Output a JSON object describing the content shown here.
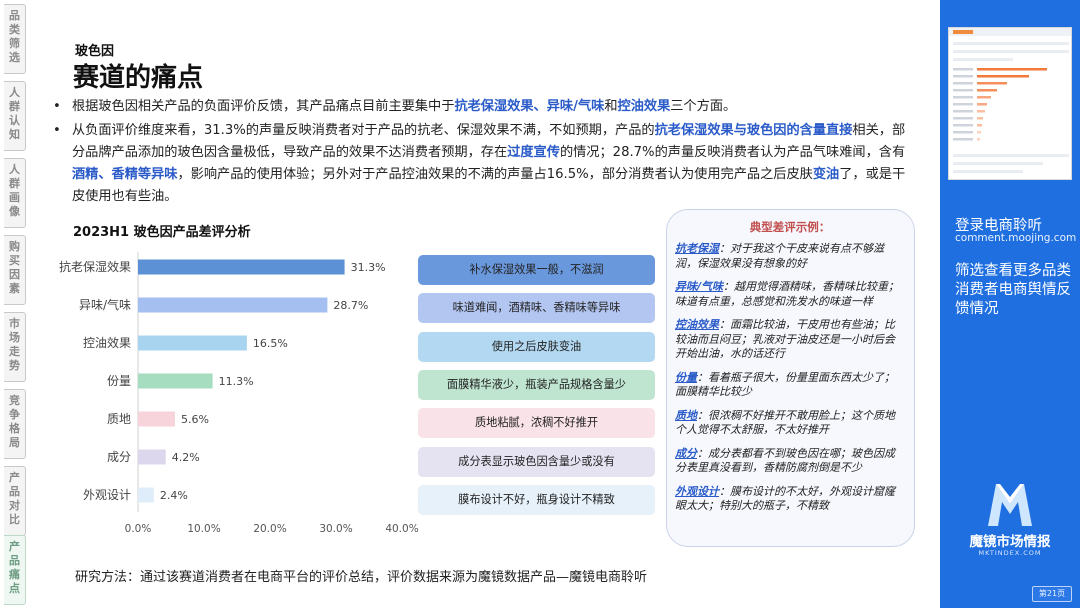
{
  "left_tabs": [
    {
      "label": [
        "品",
        "类",
        "筛",
        "选"
      ],
      "active": false
    },
    {
      "label": [
        "人",
        "群",
        "认",
        "知"
      ],
      "active": false
    },
    {
      "label": [
        "人",
        "群",
        "画",
        "像"
      ],
      "active": false
    },
    {
      "label": [
        "购",
        "买",
        "因",
        "素"
      ],
      "active": false
    },
    {
      "label": [
        "市",
        "场",
        "走",
        "势"
      ],
      "active": false
    },
    {
      "label": [
        "竞",
        "争",
        "格",
        "局"
      ],
      "active": false
    },
    {
      "label": [
        "产",
        "品",
        "对",
        "比"
      ],
      "active": false
    },
    {
      "label": [
        "产",
        "品",
        "痛",
        "点"
      ],
      "active": true
    }
  ],
  "header": {
    "subtitle": "玻色因",
    "title": "赛道的痛点"
  },
  "bullets": [
    {
      "segments": [
        {
          "t": "根据玻色因相关产品的负面评价反馈，其产品痛点目前主要集中于",
          "hl": false
        },
        {
          "t": "抗老保湿效果、异味/气味",
          "hl": true
        },
        {
          "t": "和",
          "hl": false
        },
        {
          "t": "控油效果",
          "hl": true
        },
        {
          "t": "三个方面。",
          "hl": false
        }
      ]
    },
    {
      "segments": [
        {
          "t": "从负面评价维度来看，31.3%的声量反映消费者对于产品的抗老、保湿效果不满，不如预期，产品的",
          "hl": false
        },
        {
          "t": "抗老保湿效果与玻色因的含量直接",
          "hl": true
        },
        {
          "t": "相关，部分品牌产品添加的玻色因含量极低，导致产品的效果不达消费者预期，存在",
          "hl": false
        },
        {
          "t": "过度宣传",
          "hl": true
        },
        {
          "t": "的情况；28.7%的声量反映消费者认为产品气味难闻，含有",
          "hl": false
        },
        {
          "t": "酒精、香精等异味",
          "hl": true
        },
        {
          "t": "，影响产品的使用体验；另外对于产品控油效果的不满的声量占16.5%，部分消费者认为使用完产品之后皮肤",
          "hl": false
        },
        {
          "t": "变油",
          "hl": true
        },
        {
          "t": "了，或是干皮使用也有些油。",
          "hl": false
        }
      ]
    }
  ],
  "chart_title": "2023H1 玻色因产品差评分析",
  "chart_data": {
    "type": "bar",
    "orientation": "horizontal",
    "categories": [
      "抗老保湿效果",
      "异味/气味",
      "控油效果",
      "份量",
      "质地",
      "成分",
      "外观设计"
    ],
    "values": [
      31.3,
      28.7,
      16.5,
      11.3,
      5.6,
      4.2,
      2.4
    ],
    "value_labels": [
      "31.3%",
      "28.7%",
      "16.5%",
      "11.3%",
      "5.6%",
      "4.2%",
      "2.4%"
    ],
    "colors": [
      "#5d91d6",
      "#a5bff0",
      "#a9d4ef",
      "#a6dcc0",
      "#f7d3dc",
      "#dcd7ec",
      "#dfecf9"
    ],
    "xlim": [
      0,
      40
    ],
    "x_ticks": [
      "0.0%",
      "10.0%",
      "20.0%",
      "30.0%",
      "40.0%"
    ],
    "grid": false,
    "xlabel": "",
    "ylabel": ""
  },
  "pills": [
    {
      "text": "补水保湿效果一般，不滋润",
      "color": "#6a98dc"
    },
    {
      "text": "味道难闻，酒精味、香精味等异味",
      "color": "#b3c6f1"
    },
    {
      "text": "使用之后皮肤变油",
      "color": "#b3d8f1"
    },
    {
      "text": "面膜精华液少，瓶装产品规格含量少",
      "color": "#bfe5d0"
    },
    {
      "text": "质地粘腻，浓稠不好推开",
      "color": "#f9e2e8"
    },
    {
      "text": "成分表显示玻色因含量少或没有",
      "color": "#e5e3f1"
    },
    {
      "text": "膜布设计不好，瓶身设计不精致",
      "color": "#e6f1fa"
    }
  ],
  "examples": {
    "title": "典型差评示例：",
    "items": [
      {
        "key": "抗老保湿",
        "text": "：对于我这个干皮来说有点不够滋润，保湿效果没有想象的好"
      },
      {
        "key": "异味/气味",
        "text": "：越用觉得酒精味，香精味比较重；味道有点重，总感觉和洗发水的味道一样"
      },
      {
        "key": "控油效果",
        "text": "：面霜比较油，干皮用也有些油；比较油而且闷豆；乳液对于油皮还是一小时后会开始出油，水的话还行"
      },
      {
        "key": "份量",
        "text": "：看着瓶子很大，份量里面东西太少了；面膜精华比较少"
      },
      {
        "key": "质地",
        "text": "：很浓稠不好推开不敢用脸上；这个质地个人觉得不太舒服，不太好推开"
      },
      {
        "key": "成分",
        "text": "：成分表都看不到玻色因在哪；玻色因成分表里真没看到，香精防腐剂倒是不少"
      },
      {
        "key": "外观设计",
        "text": "：膜布设计的不太好，外观设计窟窿眼太大；特别大的瓶子，不精致"
      }
    ]
  },
  "method_text": "研究方法：通过该赛道消费者在电商平台的评价总结，评价数据来源为魔镜数据产品—魔镜电商聆听",
  "right_panel": {
    "login": "登录电商聆听",
    "url": "comment.moojing.com",
    "desc": "筛选查看更多品类消费者电商舆情反馈情况",
    "logo_text": "魔镜市场情报",
    "logo_sub": "MKTINDEX.COM",
    "page_num": "第21页"
  },
  "colors": {
    "accent_blue": "#2a5bc8",
    "panel_blue": "#1f6fe0",
    "example_title_red": "#c14d4d"
  }
}
